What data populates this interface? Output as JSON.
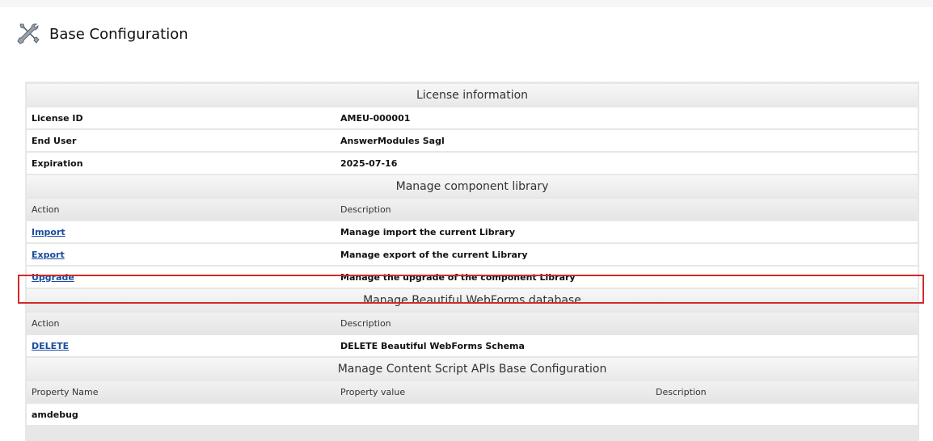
{
  "header": {
    "title": "Base Configuration",
    "icon": "tools-icon"
  },
  "license": {
    "section_title": "License information",
    "rows": [
      {
        "label": "License ID",
        "value": "AMEU-000001"
      },
      {
        "label": "End User",
        "value": "AnswerModules Sagl"
      },
      {
        "label": "Expiration",
        "value": "2025-07-16"
      }
    ]
  },
  "library": {
    "section_title": "Manage component library",
    "col_action": "Action",
    "col_description": "Description",
    "rows": [
      {
        "action": "Import",
        "description": "Manage import the current Library"
      },
      {
        "action": "Export",
        "description": "Manage export of the current Library"
      },
      {
        "action": "Upgrade",
        "description": "Manage the upgrade of the component Library"
      }
    ]
  },
  "webforms": {
    "section_title": "Manage Beautiful WebForms database",
    "col_action": "Action",
    "col_description": "Description",
    "rows": [
      {
        "action": "DELETE",
        "description": "DELETE Beautiful WebForms Schema"
      }
    ]
  },
  "contentscript": {
    "section_title": "Manage Content Script APIs Base Configuration",
    "col_property_name": "Property Name",
    "col_property_value": "Property value",
    "col_description": "Description",
    "rows": [
      {
        "name": "amdebug"
      }
    ]
  },
  "colors": {
    "link": "#1a4d9e",
    "highlight": "#d42a2a"
  }
}
